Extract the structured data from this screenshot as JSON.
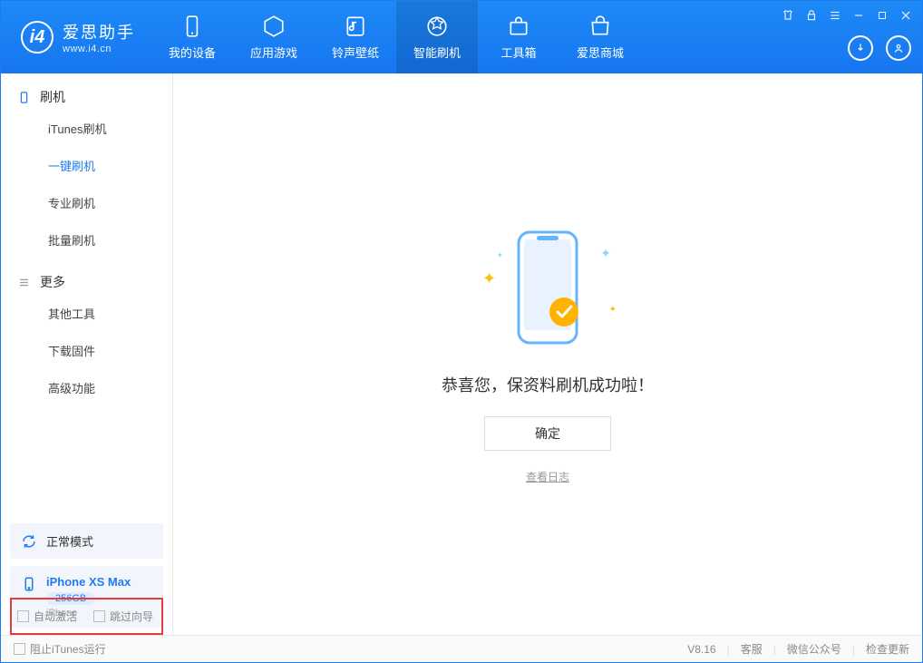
{
  "app": {
    "name": "爱思助手",
    "domain": "www.i4.cn"
  },
  "tabs": [
    "我的设备",
    "应用游戏",
    "铃声壁纸",
    "智能刷机",
    "工具箱",
    "爱思商城"
  ],
  "sidebar": {
    "sectionA": {
      "title": "刷机",
      "items": [
        "iTunes刷机",
        "一键刷机",
        "专业刷机",
        "批量刷机"
      ],
      "activeIndex": 1
    },
    "sectionB": {
      "title": "更多",
      "items": [
        "其他工具",
        "下载固件",
        "高级功能"
      ]
    }
  },
  "mode": {
    "label": "正常模式"
  },
  "device": {
    "name": "iPhone XS Max",
    "storage": "256GB",
    "type": "iPhone"
  },
  "options": {
    "autoActivate": "自动激活",
    "skipGuide": "跳过向导"
  },
  "main": {
    "successText": "恭喜您，保资料刷机成功啦！",
    "okLabel": "确定",
    "logLink": "查看日志"
  },
  "footer": {
    "blockItunes": "阻止iTunes运行",
    "version": "V8.16",
    "links": [
      "客服",
      "微信公众号",
      "检查更新"
    ]
  }
}
